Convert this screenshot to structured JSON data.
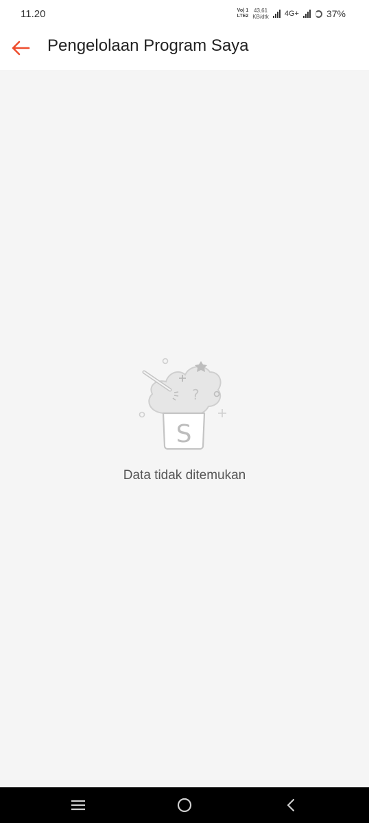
{
  "status_bar": {
    "time": "11.20",
    "volte_top": "Vo) 1",
    "volte_bottom": "LTE2",
    "speed_value": "43,61",
    "speed_unit": "KB/dtk",
    "network_type": "4G+",
    "battery_percent": "37%"
  },
  "header": {
    "title": "Pengelolaan Program Saya",
    "accent_color": "#ee4d2d"
  },
  "empty_state": {
    "logo_letter": "S",
    "message": "Data tidak ditemukan"
  },
  "nav_bar": {
    "icons": [
      "menu-icon",
      "home-circle-icon",
      "back-chevron-icon"
    ]
  }
}
